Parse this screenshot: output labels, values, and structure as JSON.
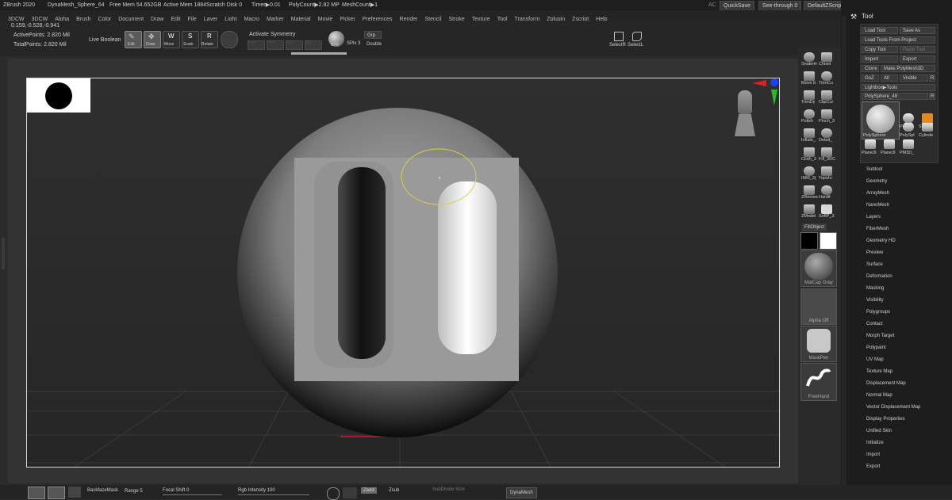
{
  "title_bar": {
    "app": "ZBrush 2020",
    "document": "DynaMesh_Sphere_64",
    "free_mem": "Free Mem 54.652GB",
    "active_mem": "Active Mem 1884",
    "scratch_disk": "Scratch Disk 0",
    "timer": "Timer▶0.01",
    "poly_count": "PolyCount▶2.82 MP",
    "mesh_count": "MeshCount▶1",
    "ac": "AC",
    "quicksave": "QuickSave",
    "see_through": "See-through 0",
    "default_zscript": "DefaultZScript"
  },
  "menu": [
    "3DCW",
    "3DCW",
    "Alpha",
    "Brush",
    "Color",
    "Document",
    "Draw",
    "Edit",
    "File",
    "Layer",
    "Light",
    "Macro",
    "Marker",
    "Material",
    "Movie",
    "Picker",
    "Preferences",
    "Render",
    "Stencil",
    "Stroke",
    "Texture",
    "Tool",
    "Transform",
    "Zplugin",
    "Zscript",
    "Help"
  ],
  "top_toolbar": {
    "coords": "0.159,-0.528,-0.941",
    "active_points": "ActivePoints: 2.820 Mil",
    "total_points": "TotalPoints: 2.820 Mil",
    "live_boolean": "Live Boolean",
    "edit": "Edit",
    "draw": "Draw",
    "move": "Move",
    "scale": "Scale",
    "rotate": "Rotate",
    "activate_symmetry": "Activate Symmetry",
    "sym_x": ">X<",
    "sym_y": ">Y<",
    "sym_z": ">Z<",
    "sym_m": "(M)",
    "grp": "Grp",
    "double": "Double",
    "spix": "SPix 3",
    "bpr": "BPR",
    "select_rect": "SelectR",
    "select_lasso": "SelectL"
  },
  "right_tray": {
    "brushes": [
      "SnakeH",
      "Chisel",
      "Move E",
      "TrimCu",
      "TrimDy",
      "ClipCur",
      "Polish",
      "Pinch_3",
      "Inflate_",
      "Detail_",
      "Cloth_3",
      "Fill_3DC",
      "IMM_3(",
      "TopoIo",
      "ZRemes",
      "Hardif",
      "ZModel",
      "SoftP_3"
    ],
    "fill_object": "FillObject",
    "material": "MatCap Gray",
    "alpha": "Alpha Off",
    "mask": "MaskPen",
    "stroke": "FreeHand"
  },
  "tool_panel": {
    "title": "Tool",
    "load_tool": "Load Tool",
    "save_as": "Save As",
    "load_from_project": "Load Tools From Project",
    "copy_tool": "Copy Tool",
    "paste_tool": "Paste Tool",
    "import": "Import",
    "export": "Export",
    "clone": "Clone",
    "make_polymesh": "Make PolyMesh3D",
    "goz": "GoZ",
    "all": "All",
    "visible": "Visible",
    "r": "R",
    "lightbox_tools": "Lightbox▶Tools",
    "polysphere": "PolySphere_48",
    "thumbs": [
      "PolySphere",
      "PolySpl",
      "Cylinde",
      "PolyMe",
      "Simplel",
      "Plane3I",
      "Plane3I",
      "PM3D_"
    ],
    "subpalettes": [
      "Subtool",
      "Geometry",
      "ArrayMesh",
      "NanoMesh",
      "Layers",
      "FiberMesh",
      "Geometry HD",
      "Preview",
      "Surface",
      "Deformation",
      "Masking",
      "Visibility",
      "Polygroups",
      "Contact",
      "Morph Target",
      "Polypaint",
      "UV Map",
      "Texture Map",
      "Displacement Map",
      "Normal Map",
      "Vector Displacement Map",
      "Display Properties",
      "Unified Skin",
      "Initialize",
      "Import",
      "Export"
    ]
  },
  "bottom_bar": {
    "backface_mask": "BackfaceMask",
    "range": "Range 5",
    "focal_shift": "Focal Shift 0",
    "rgb_intensity": "Rgb Intensity 100",
    "zadd": "Zadd",
    "zsub": "Zsub",
    "subdivide_size": "SubDivide Size",
    "dynamesh": "DynaMesh"
  },
  "colors": {
    "accent": "#d4d24a",
    "gizmo_red": "#e02020",
    "gizmo_green": "#20c020",
    "gizmo_blue": "#2040ff"
  }
}
